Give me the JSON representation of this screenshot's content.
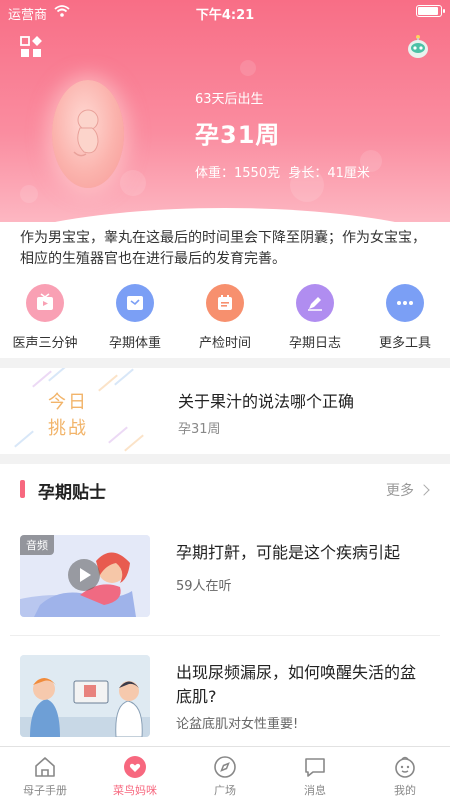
{
  "status_bar": {
    "carrier": "运营商",
    "time": "下午4:21"
  },
  "hero": {
    "countdown": "63天后出生",
    "week": "孕31周",
    "stats": "体重：1550克  身长：41厘米"
  },
  "description": "作为男宝宝，睾丸在这最后的时间里会下降至阴囊；作为女宝宝，相应的生殖器官也在进行最后的发育完善。",
  "tools": [
    {
      "label": "医声三分钟",
      "icon": "tv-icon",
      "color": "#f9a0b4"
    },
    {
      "label": "孕期体重",
      "icon": "scale-icon",
      "color": "#7b9ff5"
    },
    {
      "label": "产检时间",
      "icon": "calendar-icon",
      "color": "#f7906e"
    },
    {
      "label": "孕期日志",
      "icon": "pen-icon",
      "color": "#b08df0"
    },
    {
      "label": "更多工具",
      "icon": "more-icon",
      "color": "#7b9ff5"
    }
  ],
  "challenge": {
    "card_line1": "今日",
    "card_line2": "挑战",
    "title": "关于果汁的说法哪个正确",
    "subtitle": "孕31周"
  },
  "tips": {
    "title": "孕期贴士",
    "more": "更多",
    "articles": [
      {
        "tag": "音频",
        "title": "孕期打鼾，可能是这个疾病引起",
        "meta": "59人在听"
      },
      {
        "title": "出现尿频漏尿，如何唤醒失活的盆底肌?",
        "meta": "论盆底肌对女性重要!"
      }
    ]
  },
  "tabbar": [
    {
      "label": "母子手册",
      "icon": "house-icon",
      "active": false
    },
    {
      "label": "菜鸟妈咪",
      "icon": "heart-icon",
      "active": true
    },
    {
      "label": "广场",
      "icon": "compass-icon",
      "active": false
    },
    {
      "label": "消息",
      "icon": "message-icon",
      "active": false
    },
    {
      "label": "我的",
      "icon": "profile-icon",
      "active": false
    }
  ],
  "colors": {
    "accent": "#f7687f",
    "challenge_text": "#f2b46a"
  }
}
